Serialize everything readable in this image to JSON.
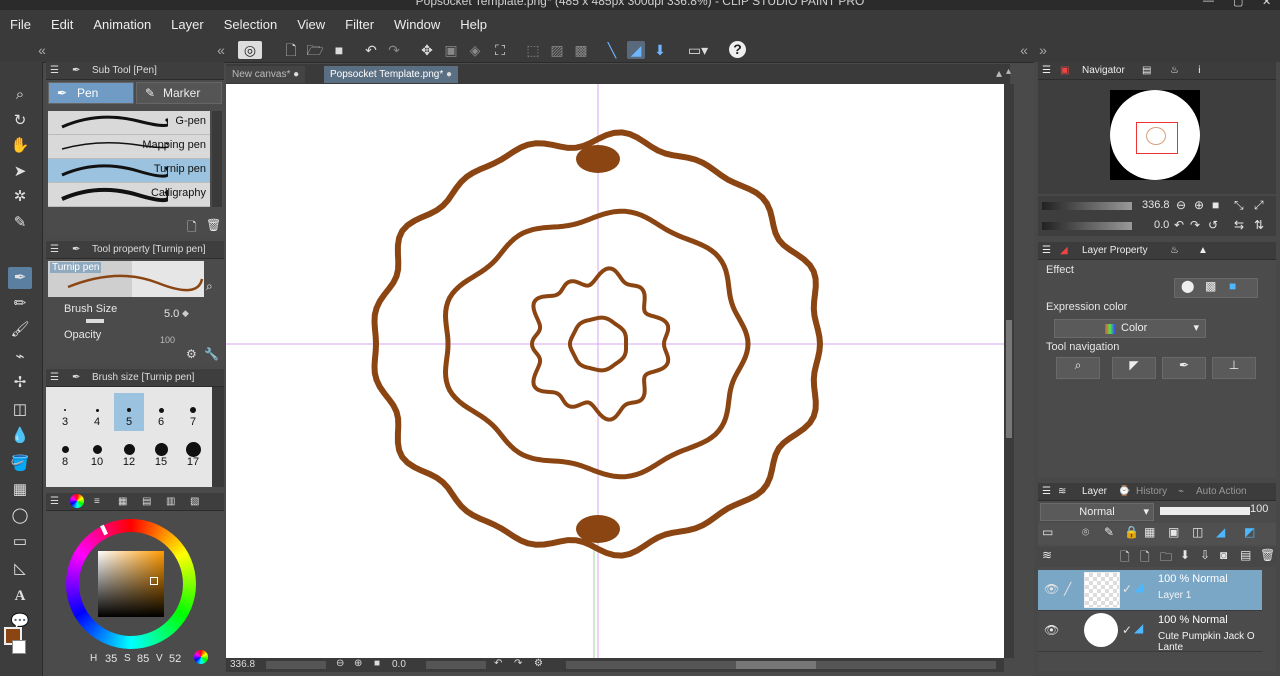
{
  "window": {
    "title": "Popsocket Template.png* (485 x 485px 300dpi 336.8%) - CLIP STUDIO PAINT PRO",
    "controls": [
      "minimize-icon",
      "maximize-icon",
      "close-icon"
    ]
  },
  "menu": [
    "File",
    "Edit",
    "Animation",
    "Layer",
    "Selection",
    "View",
    "Filter",
    "Window",
    "Help"
  ],
  "doc_tabs": [
    {
      "label": "New canvas*",
      "active": false
    },
    {
      "label": "Popsocket Template.png*",
      "active": true
    }
  ],
  "sub_tool": {
    "header": "Sub Tool [Pen]",
    "tabs": [
      "Pen",
      "Marker"
    ],
    "brushes": [
      "G-pen",
      "Mapping pen",
      "Turnip pen",
      "Calligraphy"
    ],
    "selected_brush": "Turnip pen"
  },
  "tool_property": {
    "header": "Tool property [Turnip pen]",
    "preview_label": "Turnip pen",
    "brush_size_label": "Brush Size",
    "brush_size_value": "5.0",
    "opacity_label": "Opacity",
    "opacity_value": "100"
  },
  "brush_size_panel": {
    "header": "Brush size [Turnip pen]",
    "sizes": [
      "3",
      "4",
      "5",
      "6",
      "7",
      "8",
      "10",
      "12",
      "15",
      "17"
    ],
    "selected": "5"
  },
  "color": {
    "main_color": "#8b4513",
    "hsv": {
      "h_label": "H",
      "h": "35",
      "s_label": "S",
      "s": "85",
      "v_label": "V",
      "v": "52"
    }
  },
  "status": {
    "zoom": "336.8",
    "rotation": "0.0"
  },
  "navigator": {
    "header": "Navigator",
    "zoom": "336.8",
    "rotation": "0.0"
  },
  "layer_property": {
    "header": "Layer Property",
    "effect_label": "Effect",
    "expression_color_label": "Expression color",
    "expression_color_value": "Color",
    "tool_navigation_label": "Tool navigation"
  },
  "layer_panel": {
    "tabs": [
      "Layer",
      "History",
      "Auto Action"
    ],
    "blend_mode": "Normal",
    "opacity": "100",
    "layers": [
      {
        "mode": "100 % Normal",
        "name": "Layer 1",
        "selected": true
      },
      {
        "mode": "100 % Normal",
        "name": "Cute Pumpkin Jack O Lante",
        "selected": false
      }
    ]
  },
  "stroke_color": "#8b4513"
}
